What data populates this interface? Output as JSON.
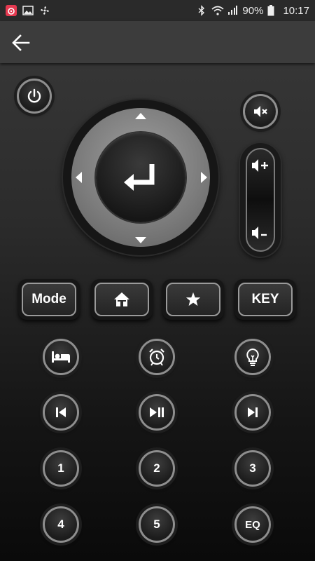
{
  "status_bar": {
    "battery": "90%",
    "time": "10:17",
    "icons": [
      "app-notification-icon",
      "image-icon",
      "fan-icon",
      "bluetooth-icon",
      "wifi-icon",
      "signal-icon",
      "battery-icon"
    ]
  },
  "header": {
    "back_icon": "arrow-left-icon"
  },
  "remote": {
    "power_icon": "power-icon",
    "mute_icon": "mute-icon",
    "volume_up_icon": "volume-up-icon",
    "volume_down_icon": "volume-down-icon",
    "ok_icon": "enter-icon",
    "mode_label": "Mode",
    "key_label": "KEY",
    "home_icon": "home-icon",
    "star_icon": "star-icon",
    "row1_icons": [
      "bed-icon",
      "alarm-clock-icon",
      "light-bulb-icon"
    ],
    "row2_icons": [
      "skip-previous-icon",
      "play-pause-icon",
      "skip-next-icon"
    ],
    "num_1": "1",
    "num_2": "2",
    "num_3": "3",
    "num_4": "4",
    "num_5": "5",
    "eq_label": "EQ"
  },
  "colors": {
    "accent_ring": "#8e8e8e",
    "dpad_ring": "#7a7a7a",
    "statusbar": "#2a2a2a",
    "appbar": "#3c3c3c"
  }
}
